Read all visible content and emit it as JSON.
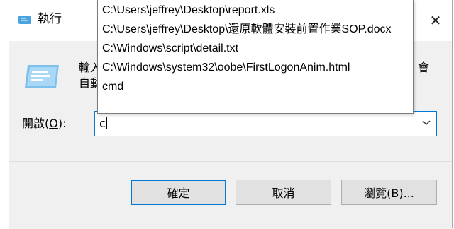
{
  "window": {
    "title": "執行",
    "close_glyph": "✕"
  },
  "description": {
    "line1": "輸入",
    "line1_tail": "會",
    "line2": "自動"
  },
  "open_field": {
    "label_prefix": "開啟(",
    "label_hotkey": "O",
    "label_suffix": "):",
    "value": "c"
  },
  "buttons": {
    "ok": "確定",
    "cancel": "取消",
    "browse": "瀏覽(B)..."
  },
  "autocomplete": {
    "items": [
      "C:\\Users\\jeffrey\\Desktop\\report.xls",
      "C:\\Users\\jeffrey\\Desktop\\還原軟體安裝前置作業SOP.docx",
      "C:\\Windows\\script\\detail.txt",
      "C:\\Windows\\system32\\oobe\\FirstLogonAnim.html",
      "cmd"
    ]
  },
  "icons": {
    "title": "run-icon",
    "main": "run-large-icon",
    "close": "close-icon",
    "combo_arrow": "chevron-down-icon"
  },
  "colors": {
    "accent": "#0078d7",
    "window_bg": "#f0f0f0",
    "button_bg": "#e1e1e1"
  }
}
